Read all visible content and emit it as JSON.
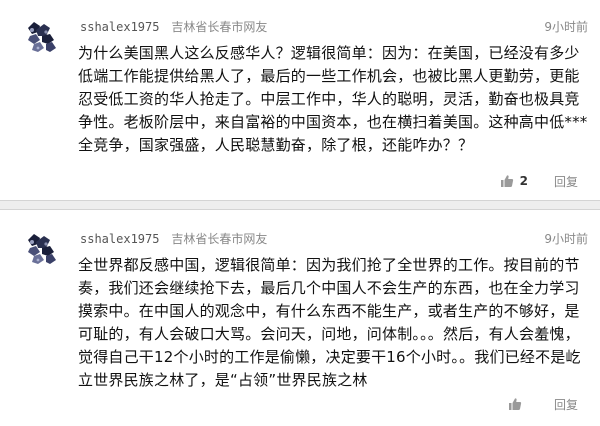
{
  "comments": [
    {
      "username": "sshalex1975",
      "location": "吉林省长春市网友",
      "time": "9小时前",
      "body": "为什么美国黑人这么反感华人？逻辑很简单：因为：在美国，已经没有多少低端工作能提供给黑人了，最后的一些工作机会，也被比黑人更勤劳，更能忍受低工资的华人抢走了。中层工作中，华人的聪明，灵活，勤奋也极具竞争性。老板阶层中，来自富裕的中国资本，也在横扫着美国。这种高中低***全竞争，国家强盛，人民聪慧勤奋，除了根，还能咋办？？",
      "likes": "2",
      "reply_label": "回复"
    },
    {
      "username": "sshalex1975",
      "location": "吉林省长春市网友",
      "time": "9小时前",
      "body": "全世界都反感中国，逻辑很简单：因为我们抢了全世界的工作。按目前的节奏，我们还会继续抢下去，最后几个中国人不会生产的东西，也在全力学习摸索中。在中国人的观念中，有什么东西不能生产，或者生产的不够好，是可耻的，有人会破口大骂。会问天，问地，问体制。。。然后，有人会羞愧，觉得自己干12个小时的工作是偷懒，决定要干16个小时。。我们已经不是屹立世界民族之林了，是“占领”世界民族之林",
      "likes": "",
      "reply_label": "回复"
    }
  ],
  "icons": {
    "avatar": "avatar",
    "like": "thumbs-up-icon"
  },
  "colors": {
    "meta": "#888888",
    "body": "#111111",
    "divider": "#eeeeee"
  }
}
